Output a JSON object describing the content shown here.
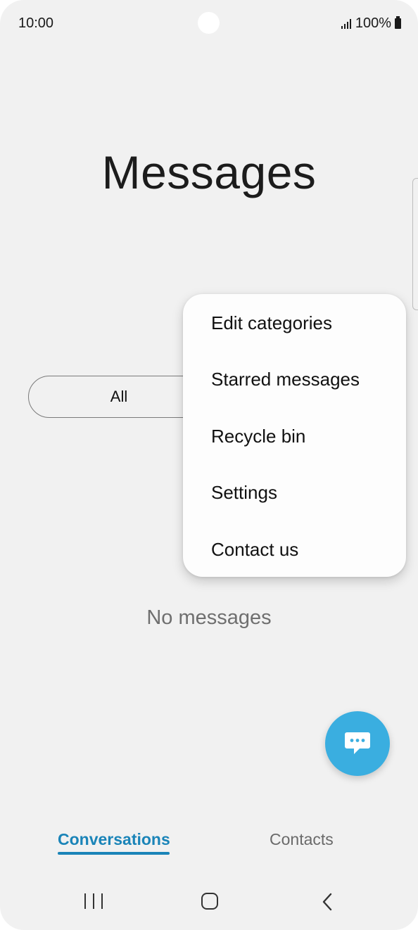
{
  "status_bar": {
    "time": "10:00",
    "battery": "100%"
  },
  "header": {
    "title": "Messages"
  },
  "categories": {
    "active_label": "All"
  },
  "menu": {
    "items": [
      {
        "label": "Edit categories"
      },
      {
        "label": "Starred messages"
      },
      {
        "label": "Recycle bin"
      },
      {
        "label": "Settings"
      },
      {
        "label": "Contact us"
      }
    ]
  },
  "main": {
    "empty_text": "No messages"
  },
  "fab": {
    "icon": "compose-message-icon",
    "color": "#3aaee0"
  },
  "bottom_tabs": [
    {
      "label": "Conversations",
      "active": true
    },
    {
      "label": "Contacts",
      "active": false
    }
  ],
  "nav_bar": {
    "icons": [
      "recents-icon",
      "home-icon",
      "back-icon"
    ]
  },
  "colors": {
    "accent": "#1a84b8",
    "background": "#f1f1f1"
  }
}
